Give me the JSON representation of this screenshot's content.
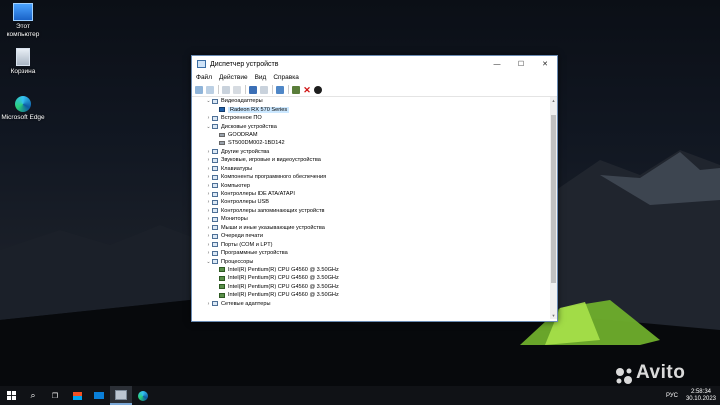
{
  "desktop": {
    "icons": [
      {
        "label": "Этот компьютер",
        "icon": "computer-icon"
      },
      {
        "label": "Корзина",
        "icon": "recycle-bin-icon"
      },
      {
        "label": "Microsoft Edge",
        "icon": "edge-icon"
      }
    ]
  },
  "window": {
    "title": "Диспетчер устройств",
    "controls": {
      "minimize": "—",
      "maximize": "☐",
      "close": "✕"
    },
    "menu": [
      "Файл",
      "Действие",
      "Вид",
      "Справка"
    ]
  },
  "tree": [
    {
      "label": "Видеоадаптеры",
      "level": 1,
      "expanded": true,
      "icon": "display-adapter-icon"
    },
    {
      "label": "Radeon RX 570 Series",
      "level": 2,
      "selected": true,
      "icon": "gpu-icon"
    },
    {
      "label": "Встроенное ПО",
      "level": 1,
      "expanded": false,
      "icon": "firmware-icon"
    },
    {
      "label": "Дисковые устройства",
      "level": 1,
      "expanded": true,
      "icon": "disk-drives-icon"
    },
    {
      "label": "GOODRAM",
      "level": 2,
      "icon": "disk-icon"
    },
    {
      "label": "ST500DM002-1BD142",
      "level": 2,
      "icon": "disk-icon"
    },
    {
      "label": "Другие устройства",
      "level": 1,
      "expanded": false,
      "icon": "other-devices-icon"
    },
    {
      "label": "Звуковые, игровые и видеоустройства",
      "level": 1,
      "expanded": false,
      "icon": "sound-icon"
    },
    {
      "label": "Клавиатуры",
      "level": 1,
      "expanded": false,
      "icon": "keyboard-icon"
    },
    {
      "label": "Компоненты программного обеспечения",
      "level": 1,
      "expanded": false,
      "icon": "software-component-icon"
    },
    {
      "label": "Компьютер",
      "level": 1,
      "expanded": false,
      "icon": "computer-icon"
    },
    {
      "label": "Контроллеры IDE ATA/ATAPI",
      "level": 1,
      "expanded": false,
      "icon": "ide-controller-icon"
    },
    {
      "label": "Контроллеры USB",
      "level": 1,
      "expanded": false,
      "icon": "usb-icon"
    },
    {
      "label": "Контроллеры запоминающих устройств",
      "level": 1,
      "expanded": false,
      "icon": "storage-controller-icon"
    },
    {
      "label": "Мониторы",
      "level": 1,
      "expanded": false,
      "icon": "monitor-icon"
    },
    {
      "label": "Мыши и иные указывающие устройства",
      "level": 1,
      "expanded": false,
      "icon": "mouse-icon"
    },
    {
      "label": "Очереди печати",
      "level": 1,
      "expanded": false,
      "icon": "print-queue-icon"
    },
    {
      "label": "Порты (COM и LPT)",
      "level": 1,
      "expanded": false,
      "icon": "port-icon"
    },
    {
      "label": "Программные устройства",
      "level": 1,
      "expanded": false,
      "icon": "software-device-icon"
    },
    {
      "label": "Процессоры",
      "level": 1,
      "expanded": true,
      "icon": "processor-icon"
    },
    {
      "label": "Intel(R) Pentium(R) CPU G4560 @ 3.50GHz",
      "level": 2,
      "icon": "cpu-icon"
    },
    {
      "label": "Intel(R) Pentium(R) CPU G4560 @ 3.50GHz",
      "level": 2,
      "icon": "cpu-icon"
    },
    {
      "label": "Intel(R) Pentium(R) CPU G4560 @ 3.50GHz",
      "level": 2,
      "icon": "cpu-icon"
    },
    {
      "label": "Intel(R) Pentium(R) CPU G4560 @ 3.50GHz",
      "level": 2,
      "icon": "cpu-icon"
    },
    {
      "label": "Сетевые адаптеры",
      "level": 1,
      "expanded": false,
      "icon": "network-adapter-icon"
    }
  ],
  "taskbar": {
    "lang": "РУС",
    "time": "2:58:34",
    "date": "30.10.2023"
  },
  "watermark": "Avito",
  "colors": {
    "accent": "#0078d7",
    "selection": "#cce8ff"
  }
}
